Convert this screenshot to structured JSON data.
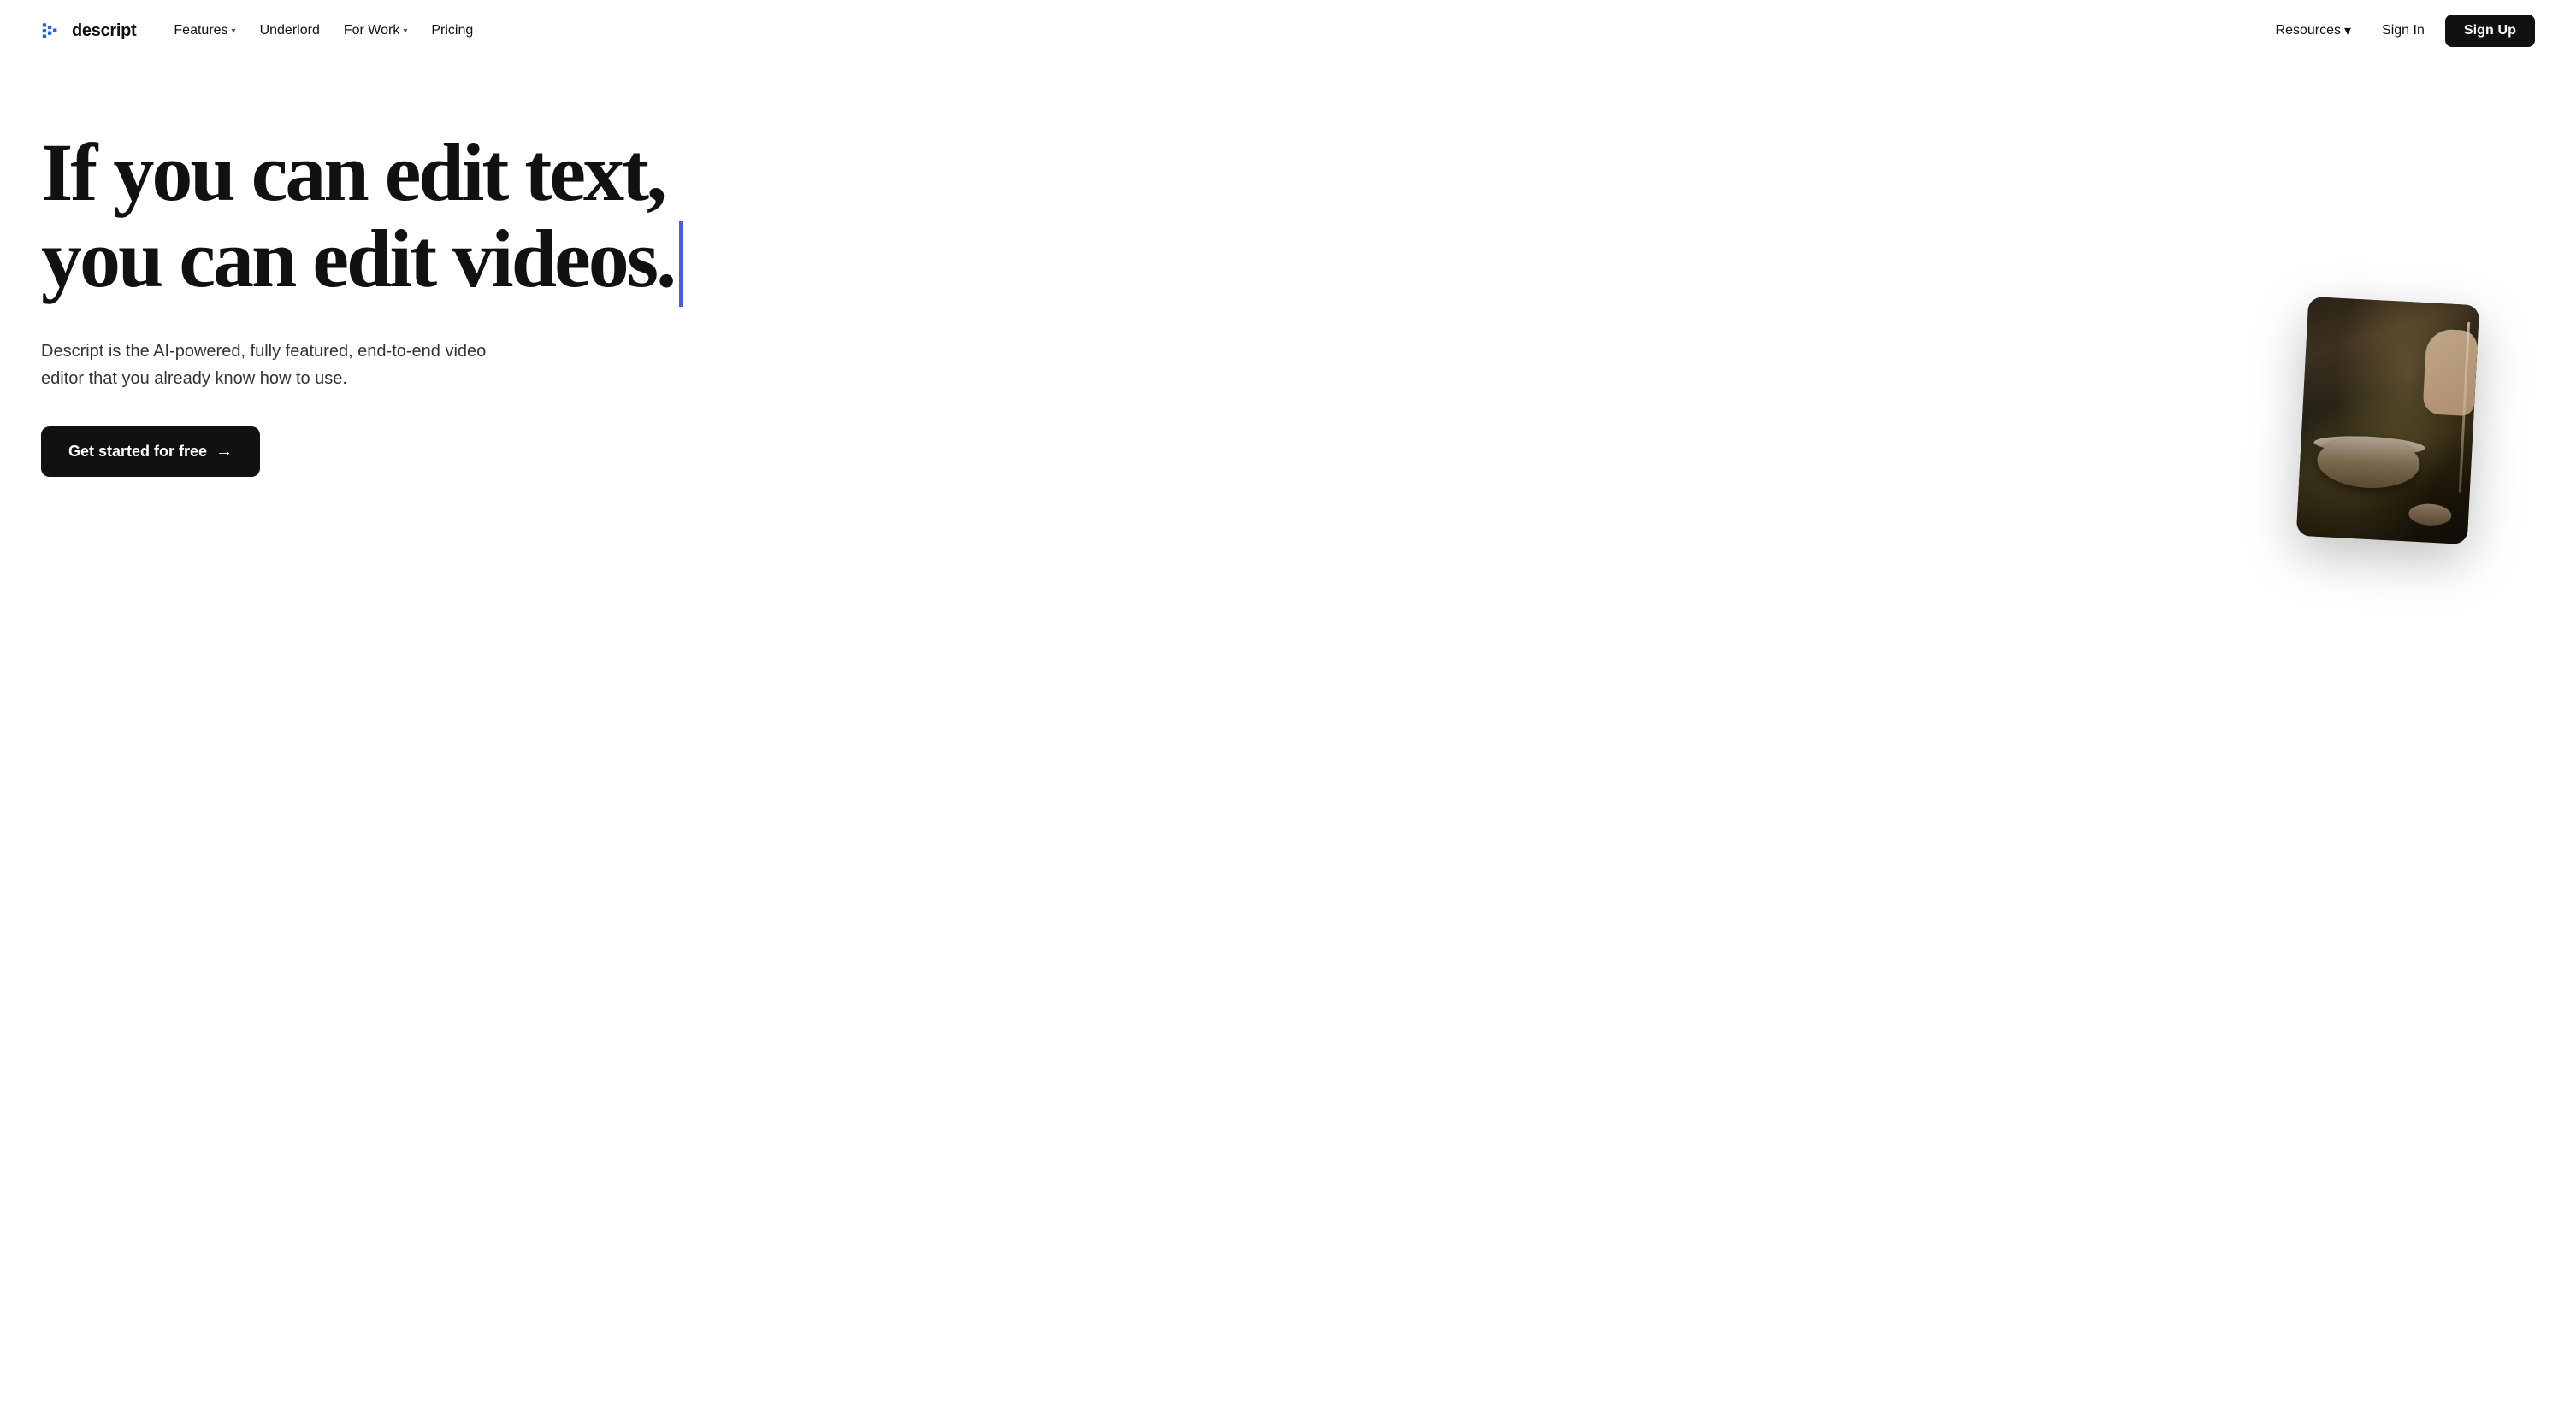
{
  "brand": {
    "name": "descript",
    "logo_aria": "Descript logo"
  },
  "nav": {
    "left": {
      "links": [
        {
          "label": "Features",
          "has_dropdown": true,
          "id": "features"
        },
        {
          "label": "Underlord",
          "has_dropdown": false,
          "id": "underlord"
        },
        {
          "label": "For Work",
          "has_dropdown": true,
          "id": "for-work"
        },
        {
          "label": "Pricing",
          "has_dropdown": false,
          "id": "pricing"
        }
      ]
    },
    "right": {
      "resources_label": "Resources",
      "resources_has_dropdown": true,
      "sign_in_label": "Sign In",
      "sign_up_label": "Sign Up"
    }
  },
  "hero": {
    "headline_line1": "If you can edit text,",
    "headline_line2": "you can edit videos.",
    "subtext": "Descript is the AI-powered, fully featured, end-to-end video editor that you already know how to use.",
    "cta_label": "Get started for free",
    "cta_arrow": "→"
  }
}
